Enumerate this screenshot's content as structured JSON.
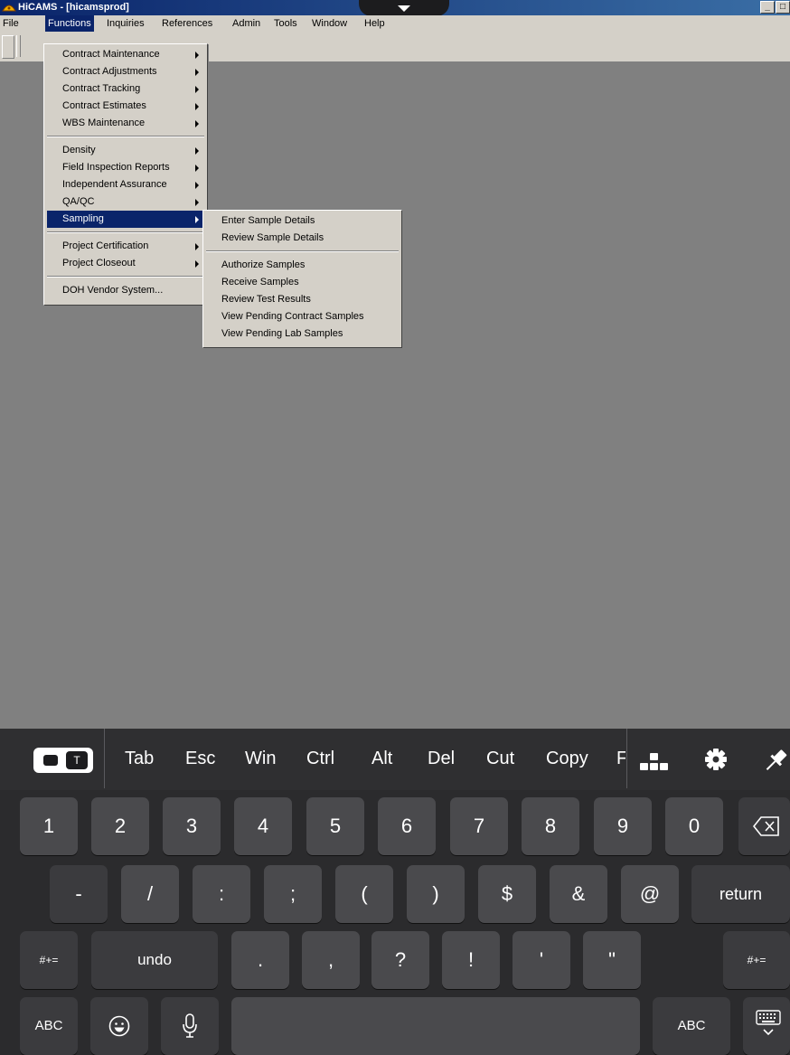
{
  "window": {
    "title": "HiCAMS - [hicamsprod]",
    "controls": [
      "_",
      "□"
    ]
  },
  "menubar": [
    "File",
    "Functions",
    "Inquiries",
    "References",
    "Admin",
    "Tools",
    "Window",
    "Help"
  ],
  "functions_menu": {
    "group1": [
      "Contract Maintenance",
      "Contract Adjustments",
      "Contract Tracking",
      "Contract Estimates",
      "WBS Maintenance"
    ],
    "group2": [
      "Density",
      "Field Inspection Reports",
      "Independent Assurance",
      "QA/QC",
      "Sampling"
    ],
    "group3": [
      "Project Certification",
      "Project Closeout"
    ],
    "group4": [
      "DOH Vendor System..."
    ],
    "highlighted": "Sampling"
  },
  "sampling_submenu": {
    "group1": [
      "Enter Sample Details",
      "Review Sample Details"
    ],
    "group2": [
      "Authorize Samples",
      "Receive Samples",
      "Review Test Results",
      "View Pending Contract Samples",
      "View Pending Lab Samples"
    ]
  },
  "keyboard": {
    "toggle_label": "T",
    "accessory_keys": [
      "Tab",
      "Esc",
      "Win",
      "Ctrl",
      "Alt",
      "Del",
      "Cut",
      "Copy",
      "F"
    ],
    "row1": [
      "1",
      "2",
      "3",
      "4",
      "5",
      "6",
      "7",
      "8",
      "9",
      "0"
    ],
    "row2": [
      "-",
      "/",
      ":",
      ";",
      "(",
      ")",
      "$",
      "&",
      "@"
    ],
    "row2_return": "return",
    "row3_left": "#+=",
    "row3_undo": "undo",
    "row3": [
      ".",
      ",",
      "?",
      "!",
      "'",
      "\""
    ],
    "row3_right": "#+=",
    "row4_left": "ABC",
    "row4_right": "ABC"
  }
}
